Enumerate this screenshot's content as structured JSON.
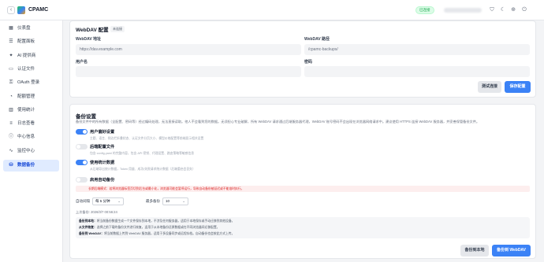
{
  "header": {
    "back_icon": "chevron-left-icon",
    "app_title": "CPAMC",
    "status": "已连接",
    "icons": [
      "shield-icon",
      "moon-icon",
      "globe-icon",
      "power-icon"
    ]
  },
  "sidebar": {
    "items": [
      {
        "label": "仪表盘",
        "icon": "dashboard-icon"
      },
      {
        "label": "配置面板",
        "icon": "config-icon"
      },
      {
        "label": "AI 提供商",
        "icon": "ai-icon"
      },
      {
        "label": "认证文件",
        "icon": "file-icon"
      },
      {
        "label": "OAuth 登录",
        "icon": "key-icon"
      },
      {
        "label": "配额管理",
        "icon": "quota-icon"
      },
      {
        "label": "使用统计",
        "icon": "chart-icon"
      },
      {
        "label": "日志查看",
        "icon": "log-icon"
      },
      {
        "label": "中心信息",
        "icon": "info-icon"
      },
      {
        "label": "监控中心",
        "icon": "monitor-icon"
      },
      {
        "label": "数据备份",
        "icon": "backup-icon",
        "active": true
      }
    ]
  },
  "webdav": {
    "title": "WebDAV 配置",
    "badge": "未连接",
    "url_label": "WebDAV 地址",
    "url_placeholder": "https://dav.example.com",
    "path_label": "WebDAV 路径",
    "path_placeholder": "/cpamc-backups/",
    "user_label": "用户名",
    "pass_label": "密码",
    "test_button": "测试连接",
    "save_button": "保存配置"
  },
  "backup": {
    "title": "备份设置",
    "desc": "备份文件中的所有数据（全配置、密码等）经过编码处理，无法直接读取。他人不会看到您的数据。无须担心专业破解，所有 WebDAV 请求通过后端服务器代理，WebDAV 账号密码不会出现在浏览器网络请求中。建议使用 HTTPS 连接 WebDAV 服务器，并妥善保管备份文件。",
    "options": [
      {
        "label": "用户偏好设置",
        "desc": "主题、语言、侧边栏折叠状态、认证文件分页大小、模型价格配置等前端显示相关设置",
        "on": true
      },
      {
        "label": "后端配置文件",
        "desc": "包含 config.yaml 的完整内容，包含 API 密钥、代理设置、路由策略等敏感信息",
        "on": false
      },
      {
        "label": "使用统计数据",
        "desc": "从后端导出统计数据，Token 用量、成功/失败请求统计数据（后端重启会丢失）",
        "on": true
      },
      {
        "label": "启用自动备份",
        "desc": "",
        "on": false
      }
    ],
    "warning": "长期后端模式：若将浏览器标签页切到后台或最小化，浏览器可能会暂停运行，导致自动备份被延迟或不能准时执行。",
    "interval_label": "自动间隔",
    "interval_value": "每 5 分钟",
    "max_label": "最多备份",
    "max_value": "10",
    "last_backup": "上次备份: 2026/3/7 00:56:24",
    "info_lines": [
      {
        "k": "备份到本地：",
        "v": "将当前备份数据生成一个文件保存到本地，不涉及任何服务器，适用于本地保存或手动迁移到其他设备。"
      },
      {
        "k": "从文件恢复：",
        "v": "选择之前下载的备份文件进行恢复，适用于从本地备份还原数据或在不同浏览器间迁移配置。"
      },
      {
        "k": "备份到 WebDAV：",
        "v": "将当前数据上传到 WebDAV 服务器，适用于多设备同步或远程存档。自动备份也会按此方式上传。"
      }
    ],
    "local_button": "备份到本地",
    "webdav_button": "备份到 WebDAV"
  },
  "colors": {
    "accent": "#3b82f6",
    "active_bg": "#e0ebff",
    "success": "#16a34a",
    "warning": "#dc2626"
  }
}
